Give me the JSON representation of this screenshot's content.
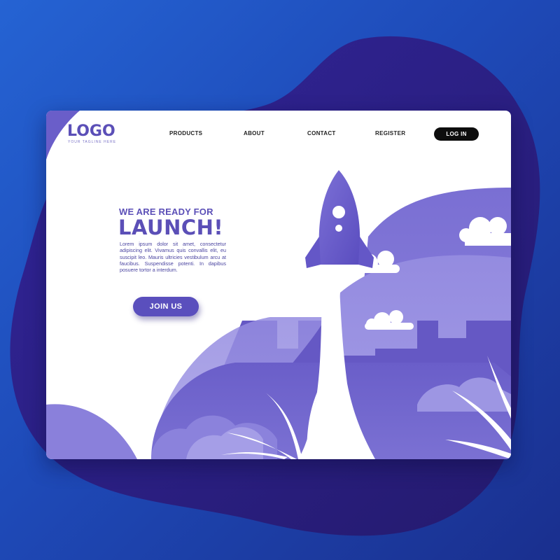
{
  "logo": {
    "text": "LOGO",
    "tagline": "YOUR TAGLINE HERE"
  },
  "nav": {
    "items": [
      {
        "label": "PRODUCTS"
      },
      {
        "label": "ABOUT"
      },
      {
        "label": "CONTACT"
      },
      {
        "label": "REGISTER"
      }
    ],
    "login_label": "LOG IN"
  },
  "hero": {
    "subtitle": "WE ARE READY FOR",
    "title": "LAUNCH!",
    "body": "Lorem ipsum dolor sit amet, consectetur adipiscing elit. Vivamus quis convallis elit, eu suscipit leo. Mauris ultricies vestibulum arcu at faucibus. Suspendisse potenti. In dapibus posuere tortor a interdum.",
    "cta_label": "JOIN US"
  },
  "colors": {
    "brand": "#5b4fb7",
    "background": "#2563d3",
    "blob": "#2a1f7a",
    "button_dark": "#0d0d0d"
  },
  "illustration": {
    "subject": "rocket launching over hills with clouds and plants"
  }
}
